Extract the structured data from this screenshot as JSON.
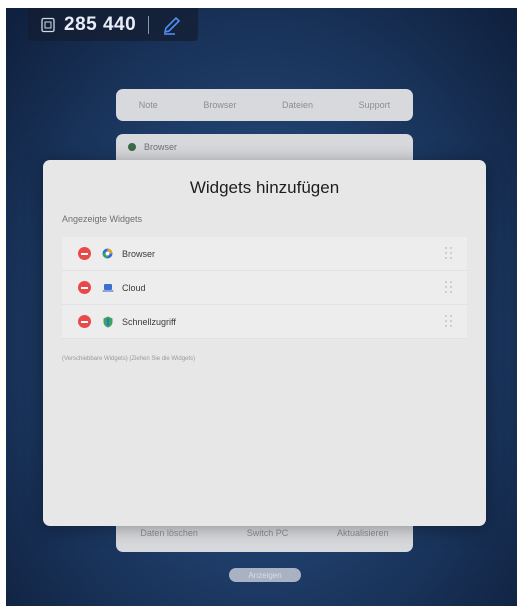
{
  "topbar": {
    "code": "285 440",
    "icons": [
      "keyboard-icon",
      "pen-icon"
    ]
  },
  "background_cards": {
    "nav": [
      "Note",
      "Browser",
      "Dateien",
      "Support"
    ],
    "browser_label": "Browser",
    "bottom": [
      "Daten löschen",
      "Switch PC",
      "Aktualisieren"
    ],
    "button_label": "Anzeigen"
  },
  "dialog": {
    "title": "Widgets hinzufügen",
    "section_label": "Angezeigte Widgets",
    "items": [
      {
        "label": "Browser",
        "icon": "browser-icon"
      },
      {
        "label": "Cloud",
        "icon": "cloud-icon"
      },
      {
        "label": "Schnellzugriff",
        "icon": "shortcut-icon"
      }
    ],
    "hint": "(Verschiebbare Widgets) (Ziehen Sie die Widgets)"
  },
  "colors": {
    "remove": "#e84a4a",
    "dialog_bg": "#e7e7e8",
    "pen": "#4e8ff0"
  }
}
